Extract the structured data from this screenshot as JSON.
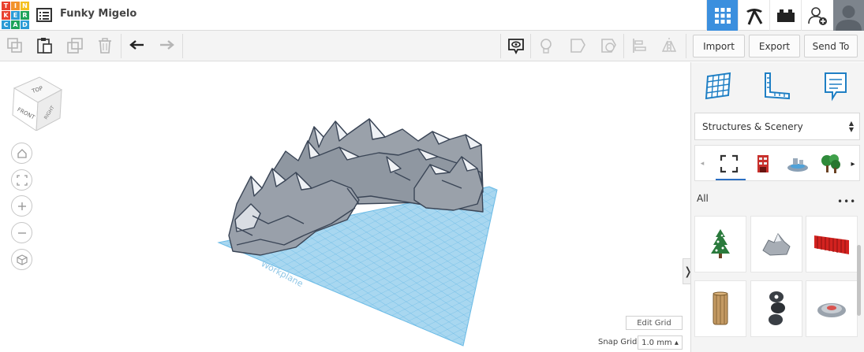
{
  "app": {
    "logo_letters": [
      "T",
      "I",
      "N",
      "K",
      "E",
      "R",
      "C",
      "A",
      "D"
    ],
    "logo_colors": [
      "#e9412f",
      "#f2922b",
      "#f4c01f",
      "#e9412f",
      "#2a9bd6",
      "#1da359",
      "#2a9bd6",
      "#1da359",
      "#2a9bd6"
    ],
    "design_title": "Funky Migelo",
    "accent": "#3b8fde"
  },
  "topbar": {
    "icons": [
      "design-grid-icon",
      "pickaxe-icon",
      "brick-icon",
      "add-user-icon",
      "avatar"
    ]
  },
  "toolbar": {
    "left_icons": [
      "copy-icon",
      "paste-icon",
      "duplicate-icon",
      "delete-icon",
      "undo-icon",
      "redo-icon"
    ],
    "right_icons": [
      "notes-icon",
      "light-bulb-icon",
      "shape-icon",
      "hole-icon",
      "align-icon",
      "mirror-icon"
    ],
    "import_label": "Import",
    "export_label": "Export",
    "send_to_label": "Send To"
  },
  "viewcube": {
    "top": "TOP",
    "front": "FRONT",
    "right": "RIGHT"
  },
  "viewport": {
    "workplane_label": "Workplane",
    "edit_grid_label": "Edit Grid",
    "snap_grid_label": "Snap Grid",
    "snap_grid_value": "1.0 mm ▴",
    "collapse_glyph": "❭"
  },
  "panel": {
    "library_select": "Structures & Scenery",
    "all_label": "All",
    "more_label": "•••",
    "category_icons": [
      "select-frame-icon",
      "building-icon",
      "fountain-icon",
      "trees-icon"
    ],
    "tiles": [
      "pine-tree",
      "rock",
      "red-fence",
      "wooden-barrel",
      "stacked-stones",
      "round-pad"
    ]
  }
}
